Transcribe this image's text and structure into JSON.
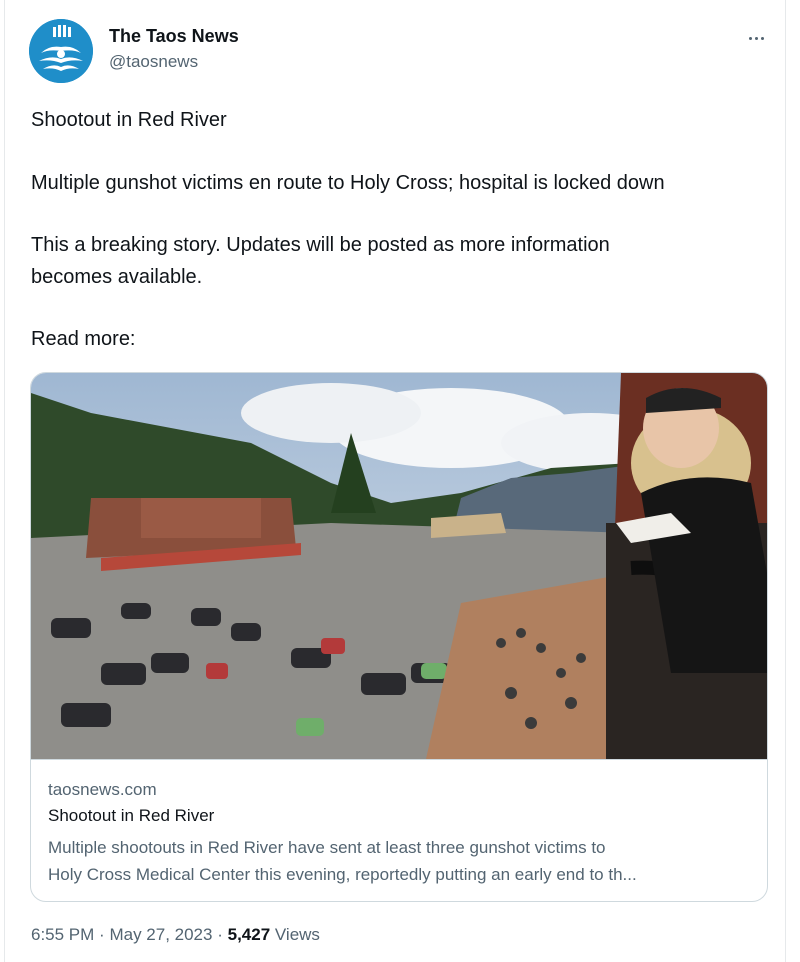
{
  "author": {
    "name": "The Taos News",
    "handle": "@taosnews",
    "avatar_icon": "zia-sun-logo",
    "avatar_color": "#1f8ec9"
  },
  "menu_icon": "more-horizontal-icon",
  "tweet": {
    "lines": [
      "Shootout in Red River",
      "Multiple gunshot victims en route to Holy Cross; hospital is locked down",
      "This a breaking story. Updates will be posted as more information",
      "becomes available.",
      "Read more:"
    ]
  },
  "card": {
    "domain": "taosnews.com",
    "title": "Shootout in Red River",
    "description_lines": [
      "Multiple shootouts in Red River have sent at least three gunshot victims to",
      "Holy Cross Medical Center this evening, reportedly putting an early end to th..."
    ]
  },
  "meta": {
    "time": "6:55 PM",
    "separator": "·",
    "date": "May 27, 2023",
    "views_count": "5,427",
    "views_label": "Views"
  }
}
